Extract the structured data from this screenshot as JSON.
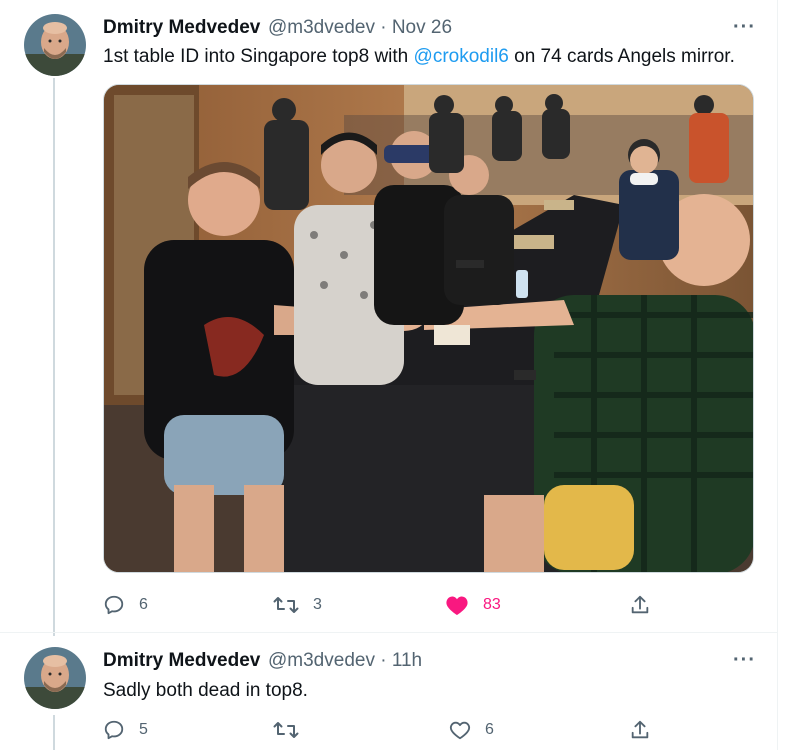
{
  "tweets": [
    {
      "author_name": "Dmitry Medvedev",
      "handle_time": "@m3dvedev · Nov 26",
      "text_before": "1st table ID into Singapore top8 with ",
      "mention": "@crokodil6",
      "text_after": " on 74 cards Angels mirror.",
      "more": "···",
      "has_photo": true,
      "actions": {
        "reply_count": "6",
        "retweet_count": "3",
        "like_count": "83",
        "liked": true
      }
    },
    {
      "author_name": "Dmitry Medvedev",
      "handle_time": "@m3dvedev · 11h",
      "text": "Sadly both dead in top8.",
      "more": "···",
      "actions": {
        "reply_count": "5",
        "retweet_count": "",
        "like_count": "6",
        "liked": false
      }
    }
  ],
  "colors": {
    "accent": "#1d9bf0",
    "like": "#f91880",
    "secondary_text": "#536471"
  }
}
